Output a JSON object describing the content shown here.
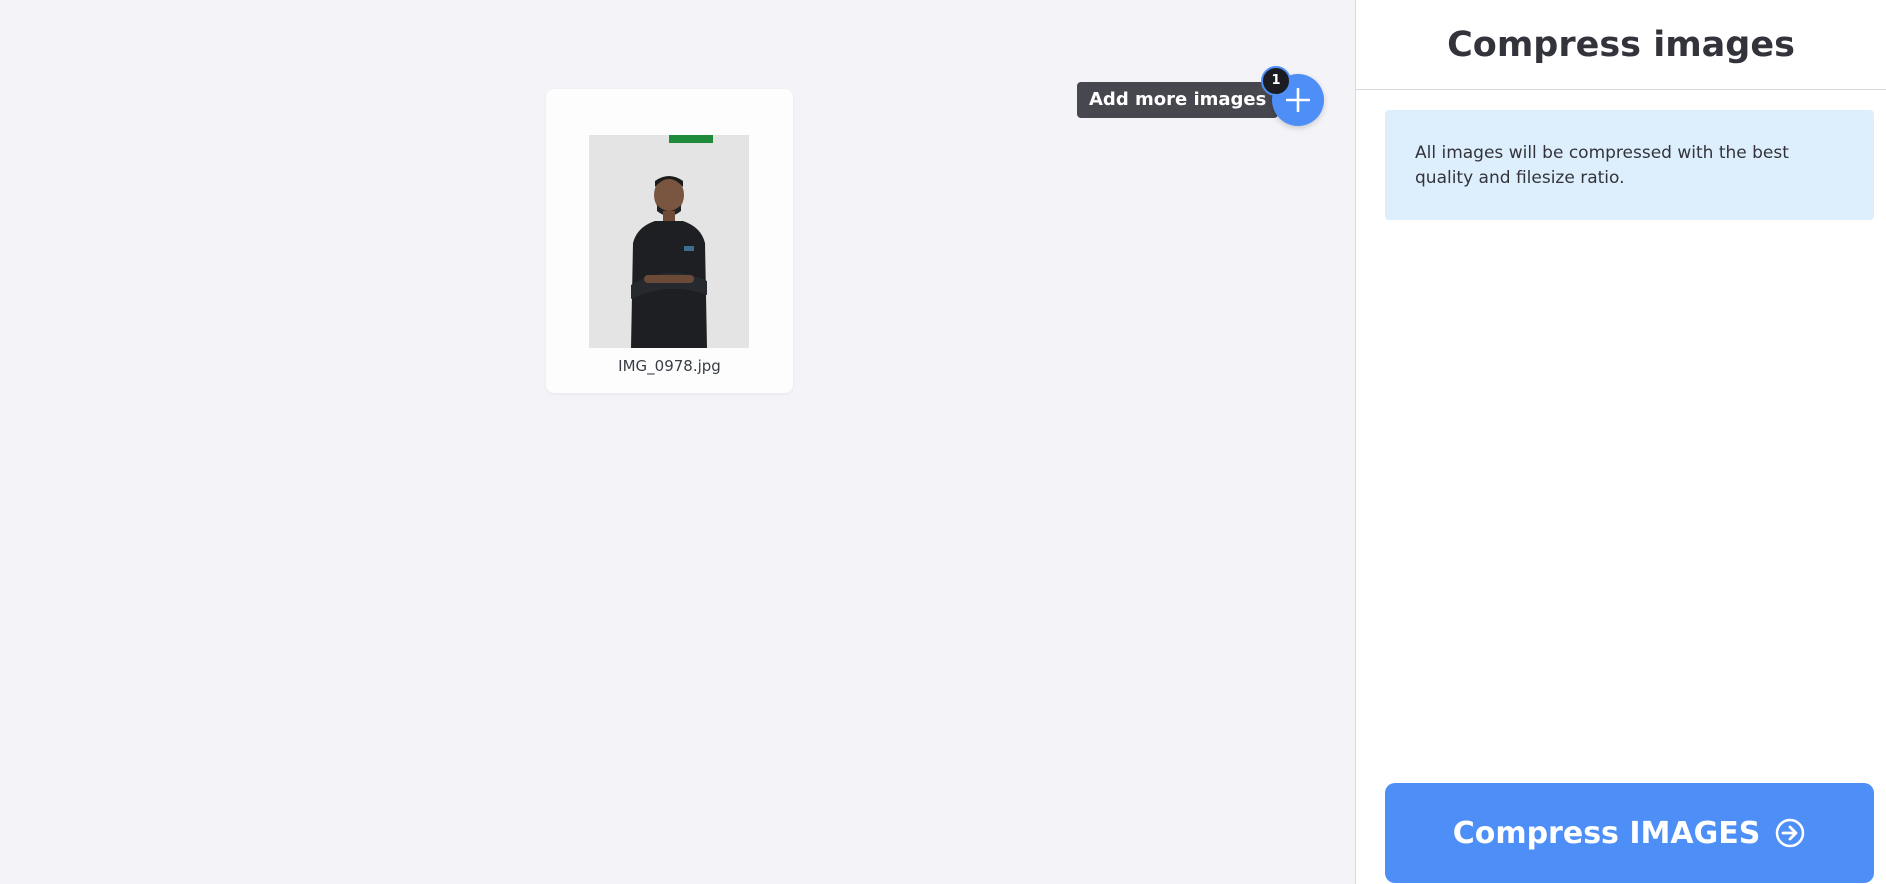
{
  "workspace": {
    "files": [
      {
        "name": "IMG_0978.jpg",
        "thumbnail_icon": "photo-thumbnail"
      }
    ],
    "add_more_tooltip": "Add more images",
    "file_count": "1",
    "add_icon": "plus-icon"
  },
  "sidebar": {
    "title": "Compress images",
    "info": "All images will be compressed with the best quality and filesize ratio.",
    "action_label": "Compress IMAGES",
    "action_icon": "arrow-circle-right-icon"
  },
  "colors": {
    "accent": "#4d8ef7",
    "info_bg": "#ddeffc",
    "workspace_bg": "#f4f4f8",
    "tooltip_bg": "#47474f"
  }
}
